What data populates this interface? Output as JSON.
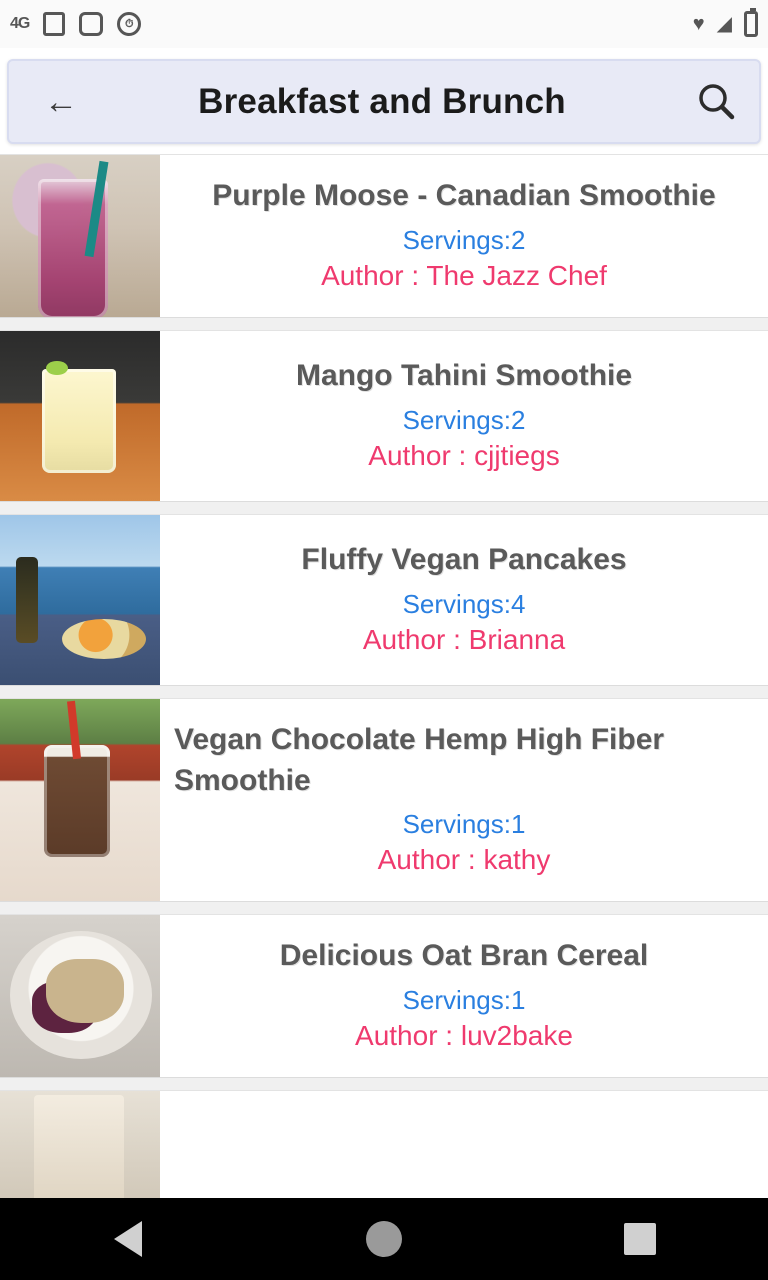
{
  "status_bar": {
    "left_icons": [
      "signal-text-icon",
      "sim-card-icon",
      "square-icon",
      "alarm-icon"
    ],
    "right_icons": [
      "heart-icon",
      "wifi-icon",
      "battery-icon"
    ],
    "signal_text": "4G"
  },
  "appbar": {
    "back_icon": "back-arrow-icon",
    "title": "Breakfast and Brunch",
    "search_icon": "search-icon"
  },
  "labels": {
    "servings_prefix": "Servings:",
    "author_prefix": "Author : "
  },
  "recipes": [
    {
      "title": "Purple Moose - Canadian Smoothie",
      "servings_text": "Servings:2",
      "author_text": "Author : The Jazz Chef",
      "servings": 2,
      "author": "The Jazz Chef",
      "thumb": "purple-smoothie-glass-photo"
    },
    {
      "title": "Mango Tahini Smoothie",
      "servings_text": "Servings:2",
      "author_text": "Author : cjjtiegs",
      "servings": 2,
      "author": "cjjtiegs",
      "thumb": "mango-smoothie-glass-photo"
    },
    {
      "title": "Fluffy Vegan Pancakes",
      "servings_text": "Servings:4",
      "author_text": "Author : Brianna",
      "servings": 4,
      "author": "Brianna",
      "thumb": "seaside-wine-fruit-photo"
    },
    {
      "title": "Vegan Chocolate Hemp High Fiber Smoothie",
      "servings_text": "Servings:1",
      "author_text": "Author : kathy",
      "servings": 1,
      "author": "kathy",
      "thumb": "chocolate-smoothie-jar-photo"
    },
    {
      "title": "Delicious Oat Bran Cereal",
      "servings_text": "Servings:1",
      "author_text": "Author : luv2bake",
      "servings": 1,
      "author": "luv2bake",
      "thumb": "oat-bran-bowl-photo"
    }
  ],
  "nav_bar": {
    "back": "nav-back-icon",
    "home": "nav-home-icon",
    "recents": "nav-recents-icon"
  },
  "colors": {
    "servings": "#2a7fe0",
    "author": "#ef3a6e",
    "title": "#5a5a5a",
    "appbar_bg": "#e8eaf6"
  }
}
